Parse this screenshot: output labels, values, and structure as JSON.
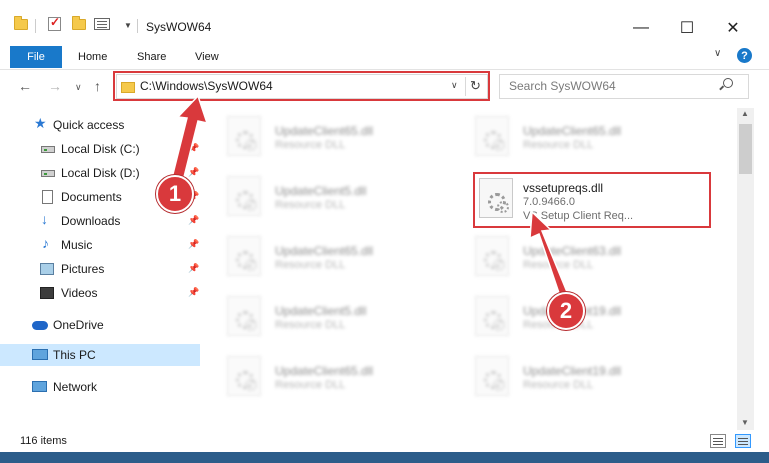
{
  "window": {
    "title": "SysWOW64",
    "minimize_glyph": "—",
    "maximize_glyph": "☐",
    "close_glyph": "✕"
  },
  "ribbon": {
    "file_tab": "File",
    "tabs": [
      "Home",
      "Share",
      "View"
    ],
    "help_glyph": "?",
    "expand_glyph": "∨"
  },
  "navigation": {
    "back_glyph": "←",
    "forward_glyph": "→",
    "recent_glyph": "∨",
    "up_glyph": "↑"
  },
  "address": {
    "path": "C:\\Windows\\SysWOW64",
    "dropdown_glyph": "∨",
    "refresh_glyph": "↻"
  },
  "search": {
    "placeholder": "Search SysWOW64"
  },
  "sidebar": {
    "items": [
      {
        "label": "Quick access"
      },
      {
        "label": "Local Disk (C:)"
      },
      {
        "label": "Local Disk (D:)"
      },
      {
        "label": "Documents"
      },
      {
        "label": "Downloads"
      },
      {
        "label": "Music"
      },
      {
        "label": "Pictures"
      },
      {
        "label": "Videos"
      },
      {
        "label": "OneDrive"
      },
      {
        "label": "This PC"
      },
      {
        "label": "Network"
      }
    ],
    "pin_glyph": "📌"
  },
  "files": [
    {
      "name": "UpdateClient65.dll",
      "desc": "Resource DLL"
    },
    {
      "name": "UpdateClient65.dll",
      "desc": "Resource DLL"
    },
    {
      "name": "UpdateClient5.dll",
      "desc": "Resource DLL"
    },
    {
      "name": "vssetupreqs.dll",
      "version": "7.0.9466.0",
      "desc": "VS Setup Client Req..."
    },
    {
      "name": "UpdateClient65.dll",
      "desc": "Resource DLL"
    },
    {
      "name": "UpdateClient63.dll",
      "desc": "Resource DLL"
    },
    {
      "name": "UpdateClient5.dll",
      "desc": "Resource DLL"
    },
    {
      "name": "UpdateClient19.dll",
      "desc": "Resource DLL"
    },
    {
      "name": "UpdateClient65.dll",
      "desc": "Resource DLL"
    },
    {
      "name": "UpdateClient19.dll",
      "desc": "Resource DLL"
    }
  ],
  "annotations": {
    "step1": "1",
    "step2": "2",
    "highlight_color": "#d9393c"
  },
  "status": {
    "item_count": "116 items"
  }
}
